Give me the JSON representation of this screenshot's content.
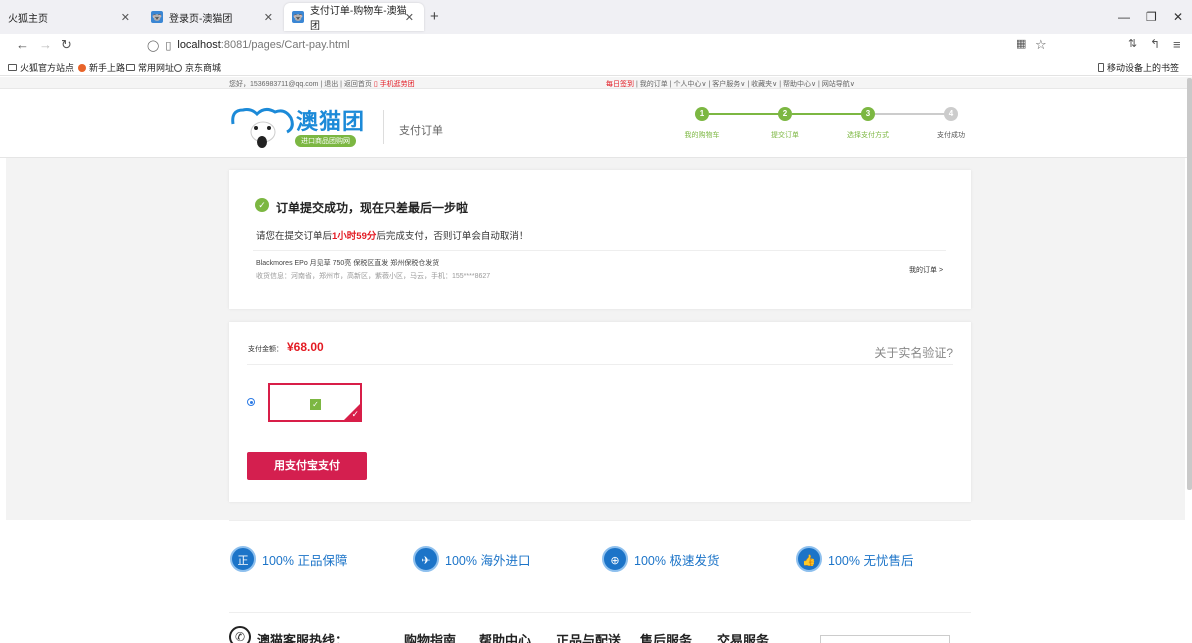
{
  "browser": {
    "tabs": [
      {
        "label": "火狐主页"
      },
      {
        "label": "登录页-澳猫团"
      },
      {
        "label": "支付订单-购物车-澳猫团"
      }
    ],
    "url_host": "localhost",
    "url_rest": ":8081/pages/Cart-pay.html",
    "bookmarks": [
      "火狐官方站点",
      "新手上路",
      "常用网址",
      "京东商城"
    ],
    "mobile_bookmarks": "移动设备上的书签"
  },
  "topbar": {
    "greeting": "您好，1536983711@qq.com",
    "logout": "退出",
    "home": "返回首页",
    "mobile": "手机逛劳团",
    "links": [
      "每日签到",
      "我的订单",
      "个人中心∨",
      "客户服务∨",
      "收藏夹∨",
      "帮助中心∨",
      "网站导航∨"
    ]
  },
  "header": {
    "logo_text": "澳猫团",
    "logo_badge": "进口商品团购网",
    "subtitle": "支付订单",
    "steps": [
      {
        "num": "1",
        "label": "我的购物车",
        "done": true
      },
      {
        "num": "2",
        "label": "提交订单",
        "done": true
      },
      {
        "num": "3",
        "label": "选择支付方式",
        "done": true
      },
      {
        "num": "4",
        "label": "支付成功",
        "done": false
      }
    ]
  },
  "order": {
    "success_title": "订单提交成功，现在只差最后一步啦",
    "tip_before": "请您在提交订单后",
    "tip_time": "1小时59分",
    "tip_after": "后完成支付，否则订单会自动取消！",
    "goods": "Blackmores EPo 月见草 750亮 保税区直发 郑州保税仓发货",
    "address": "收货信息：河南省，郑州市，高新区，紫薇小区，马云，手机：155****8627",
    "my_order_link": "我的订单 >"
  },
  "payment": {
    "amount_label": "支付金额：",
    "amount_value": "¥68.00",
    "realname_link": "关于实名验证?",
    "alipay_button": "用支付宝支付"
  },
  "guarantees": [
    {
      "icon": "正",
      "text": "100% 正品保障"
    },
    {
      "icon": "✈",
      "text": "100% 海外进口"
    },
    {
      "icon": "⊕",
      "text": "100% 极速发货"
    },
    {
      "icon": "👍",
      "text": "100% 无忧售后"
    }
  ],
  "footer": {
    "hotline": "澳猫客服热线：",
    "links": [
      "购物指南",
      "帮助中心",
      "正品与配送",
      "售后服务",
      "交易服务"
    ]
  },
  "colors": {
    "brand_blue": "#1c8ad8",
    "brand_green": "#7cb742",
    "price_red": "#e31b23",
    "pay_button": "#d41f4f"
  }
}
